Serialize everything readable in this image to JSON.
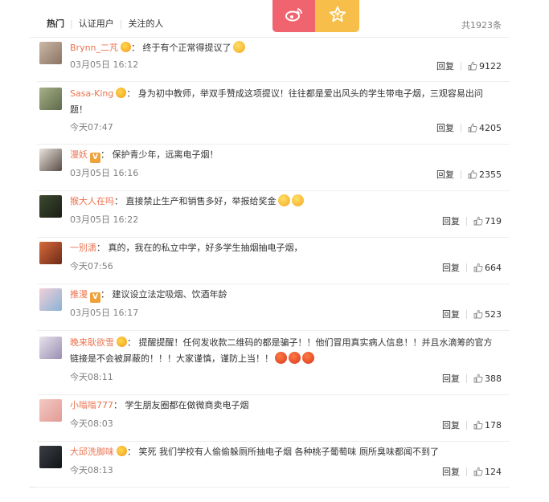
{
  "tabs": [
    "热门",
    "认证用户",
    "关注的人"
  ],
  "total": "共1923条",
  "actions": {
    "reply_label": "回复"
  },
  "comments": [
    {
      "user": "Brynn_二芃",
      "badge": "gold",
      "text": "终于有个正常得提议了",
      "emojis": [
        "smile"
      ],
      "time": "03月05日 16:12",
      "likes": "9122"
    },
    {
      "user": "Sasa-King",
      "badge": "gold",
      "text": "身为初中教师，举双手赞成这项提议！往往都是爱出风头的学生带电子烟，三观容易出问题！",
      "emojis": [],
      "time": "今天07:47",
      "likes": "4205"
    },
    {
      "user": "漫妖",
      "badge": "vip",
      "text": "保护青少年，远离电子烟！",
      "emojis": [],
      "time": "03月05日 16:16",
      "likes": "2355"
    },
    {
      "user": "猴大人在吗",
      "badge": "",
      "text": "直接禁止生产和销售多好，举报给奖金",
      "emojis": [
        "smile",
        "smile"
      ],
      "time": "03月05日 16:22",
      "likes": "719"
    },
    {
      "user": "一别潇",
      "badge": "",
      "text": "真的，我在的私立中学，好多学生抽烟抽电子烟，",
      "emojis": [],
      "time": "今天07:56",
      "likes": "664"
    },
    {
      "user": "推漫",
      "badge": "vip",
      "text": "建议设立法定吸烟、饮酒年龄",
      "emojis": [],
      "time": "03月05日 16:17",
      "likes": "523"
    },
    {
      "user": "晚来耿欲雪",
      "badge": "gold",
      "text": "提醒提醒！任何发收款二维码的都是骗子！！他们冒用真实病人信息！！并且水滴筹的官方链接是不会被屏蔽的！！！大家谨慎，谨防上当！！",
      "emojis": [
        "angry",
        "angry",
        "angry"
      ],
      "time": "今天08:11",
      "likes": "388"
    },
    {
      "user": "小嗡嗡777",
      "badge": "",
      "text": "学生朋友圈都在做微商卖电子烟",
      "emojis": [],
      "time": "今天08:03",
      "likes": "178"
    },
    {
      "user": "大邱洗脚味",
      "badge": "gold",
      "text": "笑死 我们学校有人偷偷躲厕所抽电子烟 各种桃子葡萄味 厕所臭味都闻不到了",
      "emojis": [],
      "time": "今天08:13",
      "likes": "124"
    }
  ]
}
